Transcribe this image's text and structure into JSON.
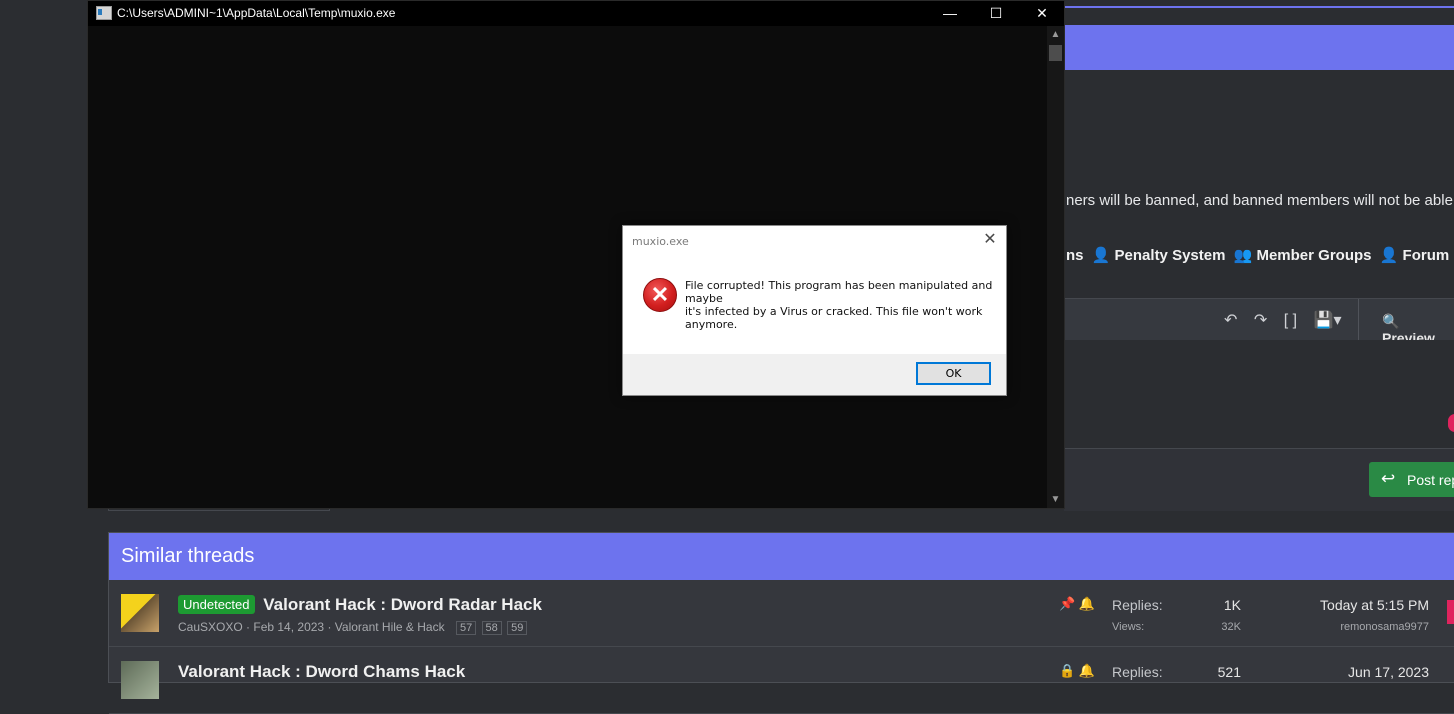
{
  "console": {
    "title": "C:\\Users\\ADMINI~1\\AppData\\Local\\Temp\\muxio.exe",
    "minimize": "—",
    "maximize": "☐",
    "close": "✕"
  },
  "dialog": {
    "title": "muxio.exe",
    "close": "✕",
    "icon": "error-icon",
    "message_lines": [
      "File corrupted! This program has been manipulated and",
      "maybe",
      "it's infected by a Virus or cracked. This file won't work",
      "anymore."
    ],
    "ok_label": "OK"
  },
  "forum": {
    "notice": "ners will be banned, and banned members will not be able",
    "nav": {
      "item1": "ns",
      "item2": "Penalty System",
      "item3": "Member Groups",
      "item4": "Forum Ru"
    },
    "toolbar": {
      "undo": "↶",
      "redo": "↷",
      "brackets": "[ ]",
      "save": "💾▾"
    },
    "preview_label": "Preview",
    "post_reply_label": "Post rep",
    "accent_color": "#6d73ee",
    "similar_threads": {
      "heading": "Similar threads",
      "threads": [
        {
          "prefix": "Undetected",
          "title": "Valorant Hack : Dword Radar Hack",
          "author": "CauSXOXO",
          "date": "Feb 14, 2023",
          "forum": "Valorant Hile & Hack",
          "pages": [
            "57",
            "58",
            "59"
          ],
          "replies_label": "Replies:",
          "replies": "1K",
          "views_label": "Views:",
          "views": "32K",
          "last_date": "Today at 5:15 PM",
          "last_user": "remonosama9977"
        },
        {
          "prefix": "",
          "title": "Valorant Hack : Dword Chams Hack",
          "replies_label": "Replies:",
          "replies": "521",
          "last_date": "Jun 17, 2023"
        }
      ]
    }
  }
}
